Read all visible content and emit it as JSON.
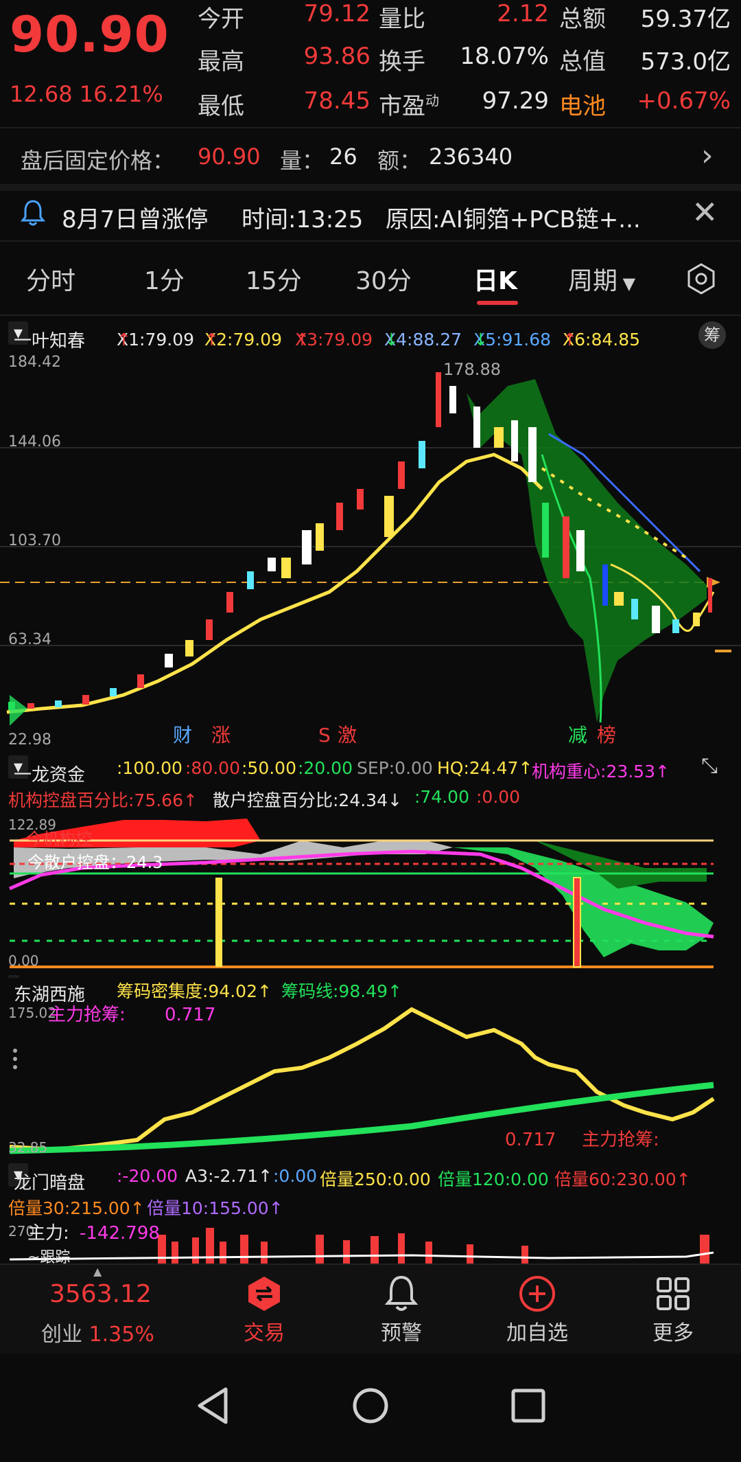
{
  "quote": {
    "price": "90.90",
    "change": "12.68",
    "change_pct": "16.21%",
    "rows": [
      [
        {
          "label": "今开",
          "value": "79.12",
          "color": "red"
        },
        {
          "label": "量比",
          "value": "2.12",
          "color": "red"
        },
        {
          "label": "总额",
          "value": "59.37亿",
          "color": "white"
        }
      ],
      [
        {
          "label": "最高",
          "value": "93.86",
          "color": "red"
        },
        {
          "label": "换手",
          "value": "18.07%",
          "color": "white"
        },
        {
          "label": "总值",
          "value": "573.0亿",
          "color": "white"
        }
      ],
      [
        {
          "label": "最低",
          "value": "78.45",
          "color": "red"
        },
        {
          "label": "市盈",
          "value": "97.29",
          "color": "white"
        },
        {
          "label": "电池",
          "value": "+0.67%",
          "color": "red"
        }
      ]
    ],
    "pe_sup": "动"
  },
  "after_hours": {
    "label": "盘后固定价格：",
    "price": "90.90",
    "vol_label": "量：",
    "vol": "26",
    "amt_label": "额：",
    "amt": "236340"
  },
  "notice": {
    "text": "8月7日曾涨停",
    "time": "时间:13:25",
    "reason": "原因:AI铜箔+PCB链+..."
  },
  "tabs": [
    "分时",
    "1分",
    "15分",
    "30分",
    "日K",
    "周期"
  ],
  "active_tab": 4,
  "kline": {
    "name": "一叶知春",
    "ma": [
      {
        "text": "X1:79.09",
        "arrow": "↑",
        "color": "#e8e8e8",
        "arrow_color": "#f23a3a"
      },
      {
        "text": "X2:79.09",
        "arrow": "↑",
        "color": "#ffe34a",
        "arrow_color": "#f23a3a"
      },
      {
        "text": "X3:79.09",
        "arrow": "↑",
        "color": "#f23a3a",
        "arrow_color": "#f23a3a"
      },
      {
        "text": "X4:88.27",
        "arrow": "↓",
        "color": "#8ab4ff",
        "arrow_color": "#22e15a"
      },
      {
        "text": "X5:91.68",
        "arrow": "↓",
        "color": "#5aa8ff",
        "arrow_color": "#22e15a"
      },
      {
        "text": "X6:84.85",
        "arrow": "↑",
        "color": "#ffe34a",
        "arrow_color": "#f23a3a"
      }
    ],
    "chip_button": "筹",
    "y_labels": [
      "184.42",
      "144.06",
      "103.70",
      "63.34",
      "22.98"
    ],
    "peak_label": "178.88",
    "markers": [
      {
        "text": "财",
        "color": "#5aa8ff"
      },
      {
        "text": "涨",
        "color": "#f23a3a"
      },
      {
        "text": "S",
        "color": "#f23a3a"
      },
      {
        "text": "激",
        "color": "#f23a3a"
      },
      {
        "text": "减",
        "color": "#22e15a"
      },
      {
        "text": "榜",
        "color": "#f23a3a"
      }
    ]
  },
  "fund": {
    "name": "一龙资金",
    "line1": [
      {
        "text": ":100.00",
        "color": "#ffe34a"
      },
      {
        "text": ":80.00",
        "color": "#f23a3a"
      },
      {
        "text": ":50.00",
        "color": "#ffe34a"
      },
      {
        "text": ":20.00",
        "color": "#22e15a"
      },
      {
        "text": "SEP:0.00",
        "color": "#9a9a9a"
      },
      {
        "text": "HQ:24.47↑",
        "color": "#ffe34a"
      },
      {
        "text": "机构重心:23.53↑",
        "color": "#ff3be8"
      }
    ],
    "line2": [
      {
        "text": "机构控盘百分比:75.66↑",
        "color": "#f23a3a"
      },
      {
        "text": "散户控盘百分比:24.34↓",
        "color": "#e8e8e8"
      },
      {
        "text": ":74.00",
        "color": "#22e15a"
      },
      {
        "text": ":0.00",
        "color": "#f23a3a"
      }
    ],
    "y_top": "122.89",
    "y_bottom": "0.00",
    "overlay1": "今机构控",
    "overlay2": "今散户控盘：24.3"
  },
  "chips": {
    "name": "东湖西施",
    "density": "筹码密集度:94.02↑",
    "line": "筹码线:98.49↑",
    "y_top": "175.02",
    "y_bottom": "32.85",
    "label_top": "主力抢筹:",
    "value_top": "0.717",
    "value_bottom": "0.717",
    "label_bottom": "主力抢筹:"
  },
  "dragon": {
    "name": "龙门暗盘",
    "line1": [
      {
        "text": ":-20.00",
        "color": "#ff3be8"
      },
      {
        "text": "A3:-2.71↑",
        "color": "#e8e8e8"
      },
      {
        "text": ":0.00",
        "color": "#5aa8ff"
      },
      {
        "text": "倍量250:0.00",
        "color": "#ffe34a"
      },
      {
        "text": "倍量120:0.00",
        "color": "#22e15a"
      },
      {
        "text": "倍量60:230.00↑",
        "color": "#f23a3a"
      }
    ],
    "line2": [
      {
        "text": "倍量30:215.00↑",
        "color": "#ff8a1f"
      },
      {
        "text": "倍量10:155.00↑",
        "color": "#b06bff"
      }
    ],
    "y_top": "270",
    "label": "主力:",
    "value": "-142.798",
    "label2": "~跟踪"
  },
  "bottom": {
    "index_value": "3563.12",
    "index_name": "创业",
    "index_pct": "1.35%",
    "nav": [
      {
        "label": "交易",
        "icon": "exchange-icon",
        "active": true
      },
      {
        "label": "预警",
        "icon": "bell-icon",
        "active": false
      },
      {
        "label": "加自选",
        "icon": "add-icon",
        "active": false
      },
      {
        "label": "更多",
        "icon": "grid-icon",
        "active": false
      }
    ]
  }
}
